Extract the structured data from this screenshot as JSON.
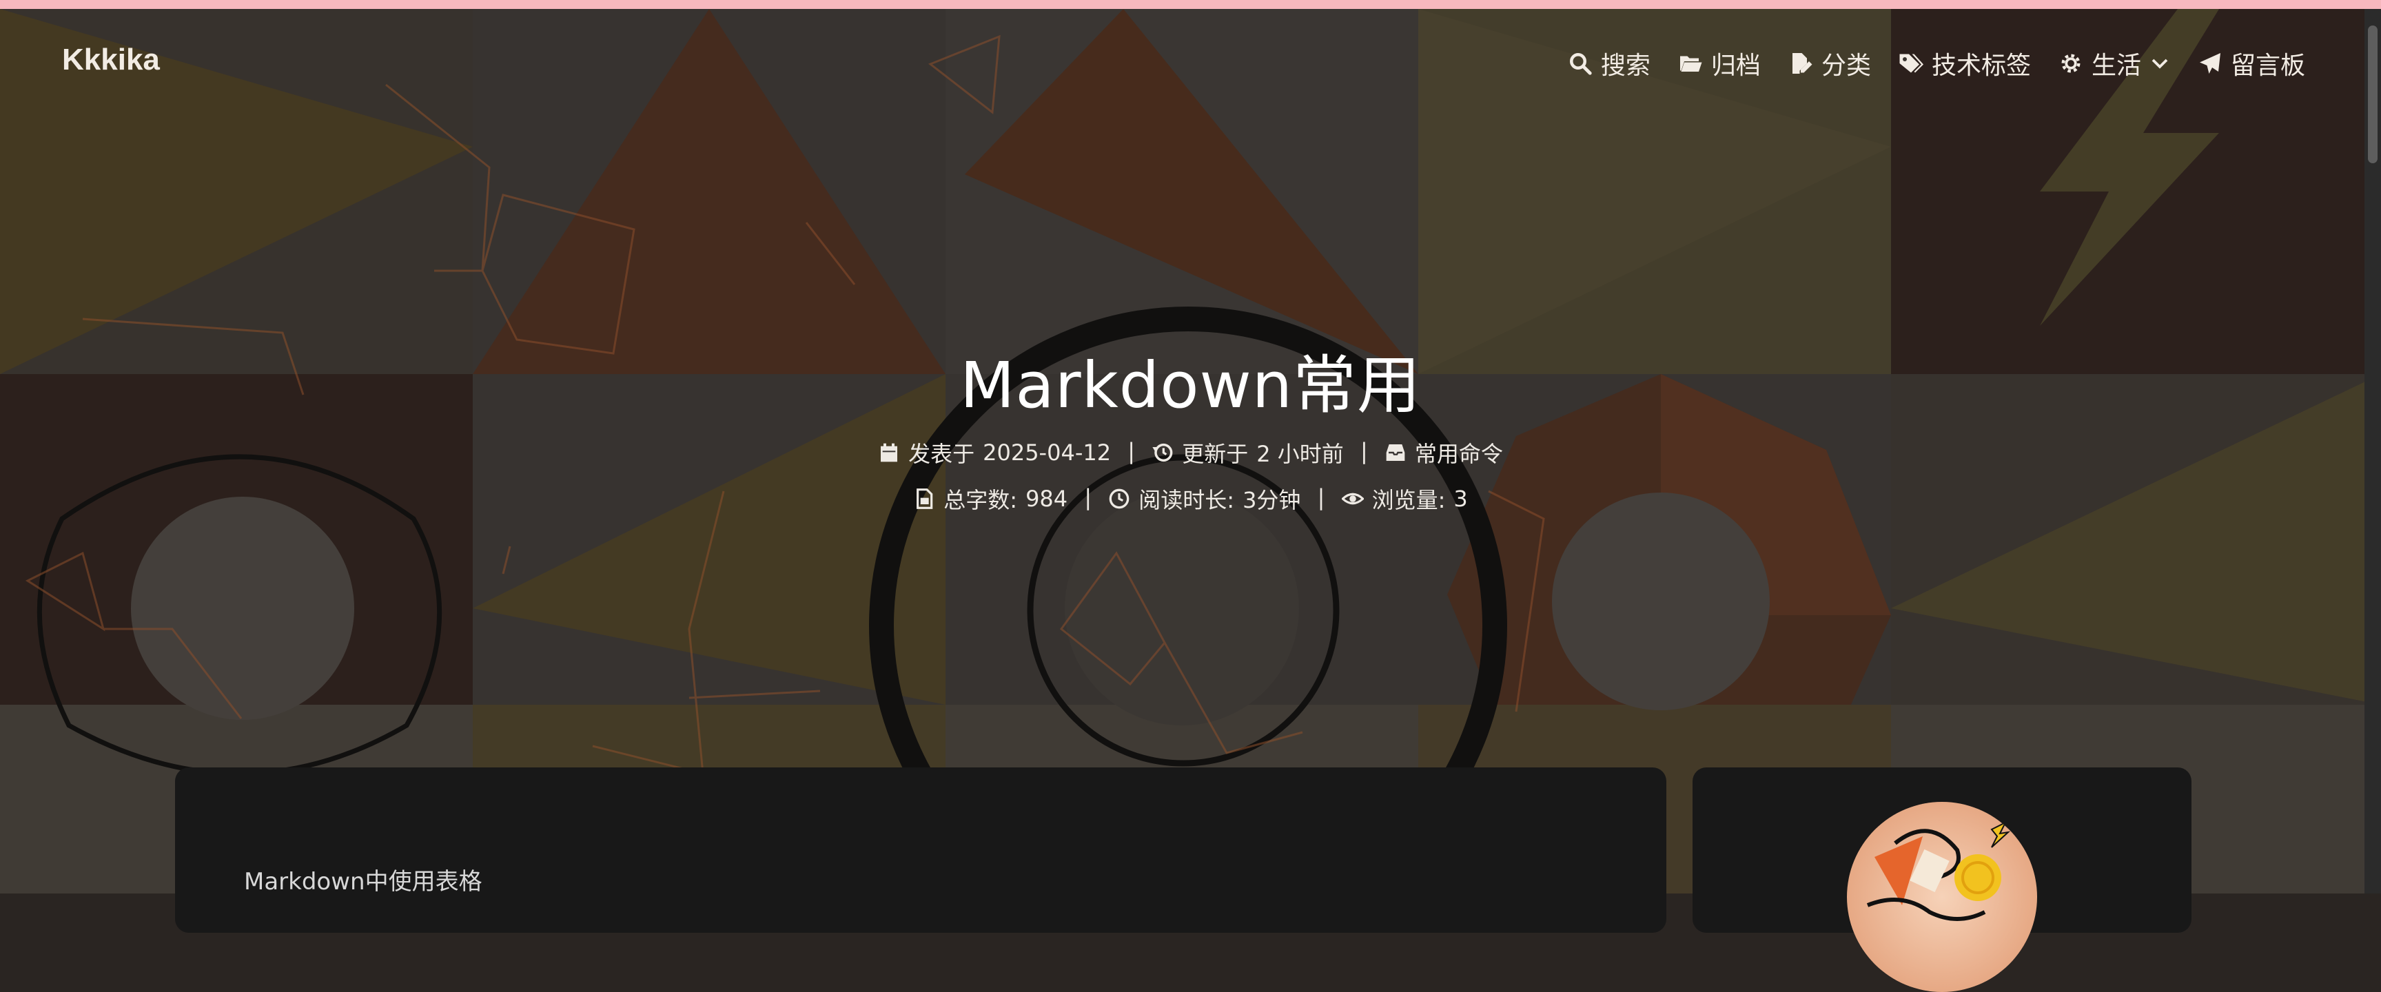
{
  "header": {
    "brand": "Kkkika",
    "nav": [
      {
        "label": "搜索",
        "icon": "search-icon"
      },
      {
        "label": "归档",
        "icon": "folder-open-icon"
      },
      {
        "label": "分类",
        "icon": "file-pen-icon"
      },
      {
        "label": "技术标签",
        "icon": "tags-icon"
      },
      {
        "label": "生活",
        "icon": "gear-icon"
      },
      {
        "label": "留言板",
        "icon": "paper-plane-icon"
      }
    ]
  },
  "post": {
    "title": "Markdown常用",
    "published_label": "发表于",
    "published_date": "2025-04-12",
    "updated_label": "更新于",
    "updated_value": "2 小时前",
    "category": "常用命令",
    "wordcount_label": "总字数:",
    "wordcount": "984",
    "readtime_label": "阅读时长:",
    "readtime": "3分钟",
    "views_label": "浏览量:",
    "views": "3",
    "separator": "|"
  },
  "content": {
    "first_heading": "Markdown中使用表格"
  },
  "colors": {
    "topline": "#f7b8be",
    "card_bg": "#181818",
    "hero_overlay": "#2a2522"
  }
}
